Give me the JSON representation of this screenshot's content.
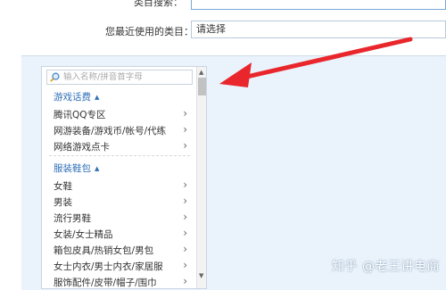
{
  "top_label_cut": "类目搜索：",
  "recent": {
    "label": "您最近使用的类目：",
    "value": "请选择"
  },
  "search": {
    "placeholder": "输入名称/拼音首字母"
  },
  "categories": [
    {
      "title": "游戏话费",
      "items": [
        "腾讯QQ专区",
        "网游装备/游戏币/帐号/代练",
        "网络游戏点卡"
      ]
    },
    {
      "title": "服装鞋包",
      "items": [
        "女鞋",
        "男装",
        "流行男鞋",
        "女装/女士精品",
        "箱包皮具/热销女包/男包",
        "女士内衣/男士内衣/家居服",
        "服饰配件/皮带/帽子/围巾"
      ]
    }
  ],
  "icons": {
    "search": "search-icon",
    "chevron": "chevron-right-icon",
    "caret": "caret-up-icon"
  },
  "colors": {
    "arrow": "#e8262c",
    "category_title": "#2f6fb6",
    "panel_bg": "#eaf2fb"
  },
  "watermark": "知乎 @老王讲电商"
}
